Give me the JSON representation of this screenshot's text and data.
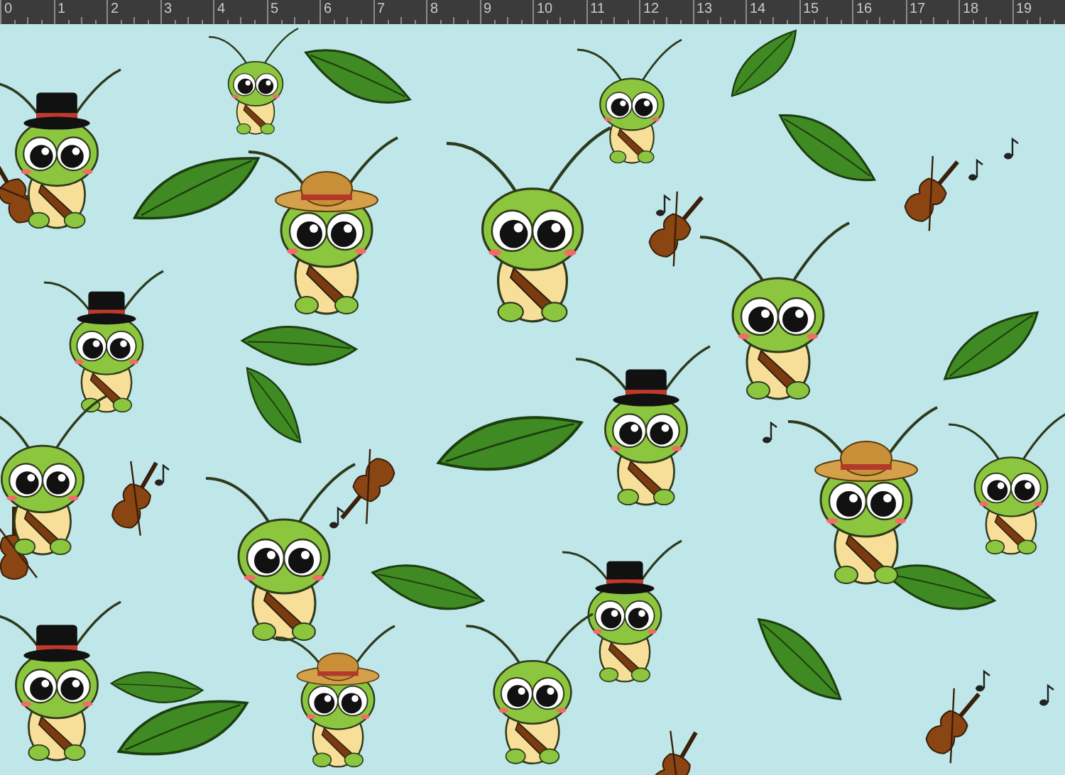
{
  "ruler": {
    "labels": [
      "0",
      "1",
      "2",
      "3",
      "4",
      "5",
      "6",
      "7",
      "8",
      "9",
      "10",
      "11",
      "12",
      "13",
      "14",
      "15",
      "16",
      "17",
      "18",
      "19"
    ]
  }
}
